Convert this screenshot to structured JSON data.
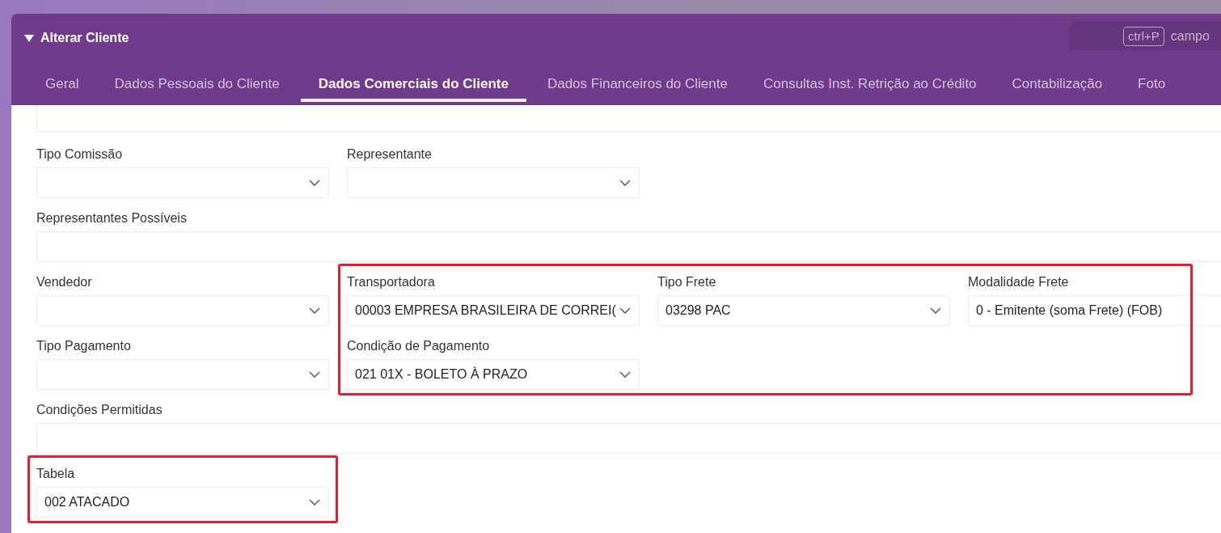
{
  "panel": {
    "title": "Alterar Cliente",
    "shortcut_key": "ctrl+P",
    "shortcut_text": "campo"
  },
  "tabs": [
    {
      "label": "Geral",
      "selected": false
    },
    {
      "label": "Dados Pessoais do Cliente",
      "selected": false
    },
    {
      "label": "Dados Comerciais do Cliente",
      "selected": true
    },
    {
      "label": "Dados Financeiros do Cliente",
      "selected": false
    },
    {
      "label": "Consultas Inst. Retrição ao Crédito",
      "selected": false
    },
    {
      "label": "Contabilização",
      "selected": false
    },
    {
      "label": "Foto",
      "selected": false
    }
  ],
  "form_rows": [
    {
      "fields": [
        {
          "kind": "input",
          "full_width": true
        }
      ]
    },
    {
      "fields": [
        {
          "kind": "select",
          "label": "Tipo Comissão"
        },
        {
          "kind": "select",
          "label": "Representante"
        }
      ]
    },
    {
      "fields": [
        {
          "kind": "input",
          "label": "Representantes Possíveis",
          "full_width": true
        }
      ]
    },
    {
      "fields": [
        {
          "kind": "select",
          "label": "Vendedor"
        },
        {
          "kind": "select",
          "label": "Transportadora",
          "value": "00003 EMPRESA BRASILEIRA DE CORREI(",
          "highlighted": true
        },
        {
          "kind": "select",
          "label": "Tipo Frete",
          "value": "03298 PAC",
          "highlighted": true
        },
        {
          "kind": "input",
          "label": "Modalidade Frete",
          "value": "0 - Emitente (soma Frete) (FOB)",
          "highlighted": true
        }
      ]
    },
    {
      "fields": [
        {
          "kind": "select",
          "label": "Tipo Pagamento"
        },
        {
          "kind": "select",
          "label": "Condição de Pagamento",
          "value": "021 01X - BOLETO À PRAZO",
          "highlighted": true
        }
      ]
    },
    {
      "fields": [
        {
          "kind": "input",
          "label": "Condições Permitidas",
          "full_width": true
        }
      ]
    },
    {
      "fields": [
        {
          "kind": "select",
          "label": "Tabela",
          "value": "002 ATACADO",
          "highlighted": true
        }
      ]
    }
  ]
}
